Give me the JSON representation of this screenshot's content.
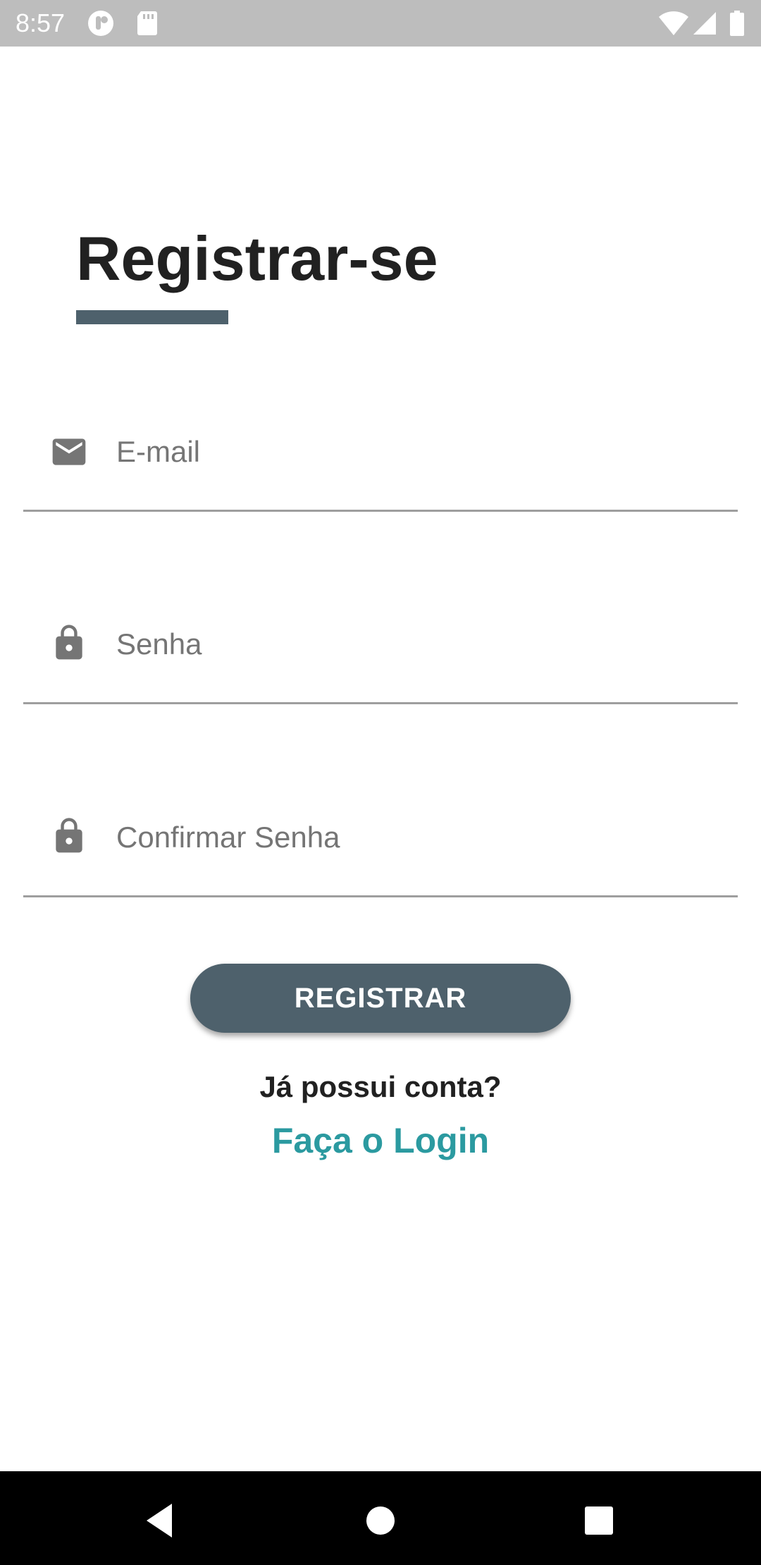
{
  "status_bar": {
    "time": "8:57",
    "icons": [
      "app-notification-icon",
      "sd-card-icon",
      "wifi-icon",
      "signal-icon",
      "battery-icon"
    ]
  },
  "header": {
    "title": "Registrar-se",
    "underline_color": "#4e616c"
  },
  "form": {
    "email": {
      "placeholder": "E-mail",
      "value": "",
      "icon": "mail-icon"
    },
    "password": {
      "placeholder": "Senha",
      "value": "",
      "icon": "lock-icon"
    },
    "confirm_password": {
      "placeholder": "Confirmar Senha",
      "value": "",
      "icon": "lock-icon"
    }
  },
  "actions": {
    "register_label": "REGISTRAR",
    "account_question": "Já possui conta?",
    "login_link": "Faça o Login"
  },
  "colors": {
    "primary": "#4e616c",
    "link": "#2b9aa0",
    "text": "#212121",
    "hint": "#757575"
  },
  "nav_bar": {
    "buttons": [
      "back-icon",
      "home-icon",
      "recents-icon"
    ]
  }
}
